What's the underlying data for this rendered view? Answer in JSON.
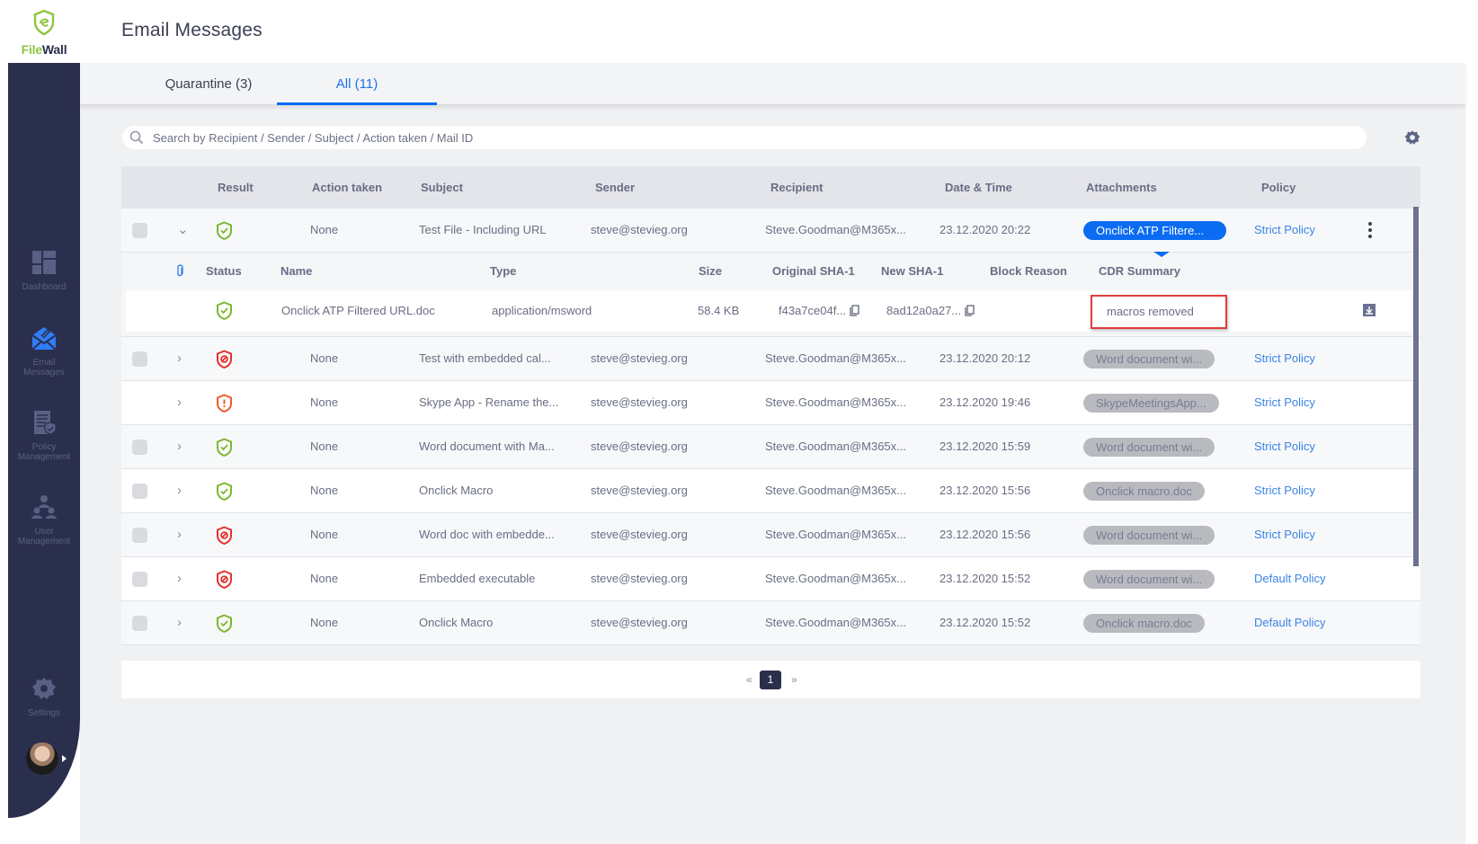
{
  "app": {
    "logo_file": "File",
    "logo_wall": "Wall"
  },
  "header": {
    "title": "Email Messages"
  },
  "sidebar": {
    "items": [
      {
        "label_1": "Dashboard",
        "label_2": "",
        "icon": "dashboard-icon"
      },
      {
        "label_1": "Email",
        "label_2": "Messages",
        "icon": "email-icon",
        "active": true
      },
      {
        "label_1": "Policy",
        "label_2": "Management",
        "icon": "policy-icon"
      },
      {
        "label_1": "User",
        "label_2": "Management",
        "icon": "users-icon"
      },
      {
        "label_1": "Settings",
        "label_2": "",
        "icon": "gear-icon"
      }
    ]
  },
  "tabs": [
    {
      "label": "Quarantine (3)",
      "active": false
    },
    {
      "label": "All (11)",
      "active": true
    }
  ],
  "search": {
    "placeholder": "Search by Recipient / Sender / Subject / Action taken / Mail ID",
    "value": ""
  },
  "table": {
    "headers": {
      "result": "Result",
      "action": "Action taken",
      "subject": "Subject",
      "sender": "Sender",
      "recipient": "Recipient",
      "datetime": "Date & Time",
      "attachments": "Attachments",
      "policy": "Policy"
    },
    "rows": [
      {
        "checkbox": true,
        "expanded": true,
        "result": "clean",
        "action": "None",
        "subject": "Test File - Including URL",
        "sender": "steve@stevieg.org",
        "recipient": "Steve.Goodman@M365x...",
        "datetime": "23.12.2020 20:22",
        "attachment": "Onclick ATP Filtere...",
        "attachment_active": true,
        "policy": "Strict Policy"
      },
      {
        "checkbox": true,
        "expanded": false,
        "result": "blocked",
        "action": "None",
        "subject": "Test with embedded cal...",
        "sender": "steve@stevieg.org",
        "recipient": "Steve.Goodman@M365x...",
        "datetime": "23.12.2020 20:12",
        "attachment": "Word document wi...",
        "policy": "Strict Policy"
      },
      {
        "checkbox": false,
        "expanded": false,
        "result": "warning",
        "action": "None",
        "subject": "Skype App - Rename the...",
        "sender": "steve@stevieg.org",
        "recipient": "Steve.Goodman@M365x...",
        "datetime": "23.12.2020 19:46",
        "attachment": "SkypeMeetingsApp...",
        "policy": "Strict Policy"
      },
      {
        "checkbox": true,
        "expanded": false,
        "result": "clean",
        "action": "None",
        "subject": "Word document with Ma...",
        "sender": "steve@stevieg.org",
        "recipient": "Steve.Goodman@M365x...",
        "datetime": "23.12.2020 15:59",
        "attachment": "Word document wi...",
        "policy": "Strict Policy"
      },
      {
        "checkbox": true,
        "expanded": false,
        "result": "clean",
        "action": "None",
        "subject": "Onclick Macro",
        "sender": "steve@stevieg.org",
        "recipient": "Steve.Goodman@M365x...",
        "datetime": "23.12.2020 15:56",
        "attachment": "Onclick macro.doc",
        "policy": "Strict Policy"
      },
      {
        "checkbox": true,
        "expanded": false,
        "result": "blocked",
        "action": "None",
        "subject": "Word doc with embedde...",
        "sender": "steve@stevieg.org",
        "recipient": "Steve.Goodman@M365x...",
        "datetime": "23.12.2020 15:56",
        "attachment": "Word document wi...",
        "policy": "Strict Policy"
      },
      {
        "checkbox": true,
        "expanded": false,
        "result": "blocked",
        "action": "None",
        "subject": "Embedded executable",
        "sender": "steve@stevieg.org",
        "recipient": "Steve.Goodman@M365x...",
        "datetime": "23.12.2020 15:52",
        "attachment": "Word document wi...",
        "policy": "Default Policy"
      },
      {
        "checkbox": true,
        "expanded": false,
        "result": "clean",
        "action": "None",
        "subject": "Onclick Macro",
        "sender": "steve@stevieg.org",
        "recipient": "Steve.Goodman@M365x...",
        "datetime": "23.12.2020 15:52",
        "attachment": "Onclick macro.doc",
        "policy": "Default Policy"
      }
    ],
    "detail": {
      "headers": {
        "status": "Status",
        "name": "Name",
        "type": "Type",
        "size": "Size",
        "orig_sha": "Original SHA-1",
        "new_sha": "New SHA-1",
        "block_reason": "Block Reason",
        "cdr_summary": "CDR Summary"
      },
      "file": {
        "status": "clean",
        "name": "Onclick ATP Filtered URL.doc",
        "type": "application/msword",
        "size": "58.4 KB",
        "orig_sha": "f43a7ce04f...",
        "new_sha": "8ad12a0a27...",
        "block_reason": "",
        "cdr_summary": "macros removed"
      }
    }
  },
  "pagination": {
    "prev": "«",
    "current": "1",
    "next": "»"
  },
  "colors": {
    "sidebar": "#2b2f4e",
    "accent": "#0b6cf2",
    "clean": "#7cb82f",
    "blocked": "#e5322d",
    "warning": "#ef5a2a",
    "highlight": "#e23a3a"
  }
}
